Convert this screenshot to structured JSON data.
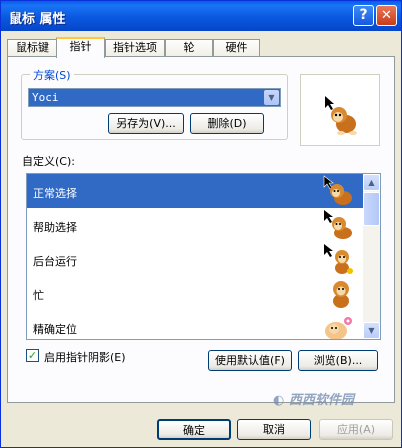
{
  "window": {
    "title": "鼠标 属性",
    "help_label": "?",
    "close_label": "✕"
  },
  "tabs": [
    {
      "label": "鼠标键"
    },
    {
      "label": "指针"
    },
    {
      "label": "指针选项"
    },
    {
      "label": "轮"
    },
    {
      "label": "硬件"
    }
  ],
  "scheme": {
    "legend": "方案(S)",
    "selected": "Yoci",
    "save_as_label": "另存为(V)...",
    "delete_label": "删除(D)"
  },
  "customize_label": "自定义(C):",
  "pointers": [
    {
      "label": "正常选择",
      "selected": true,
      "icon": "monkey-arrow-icon"
    },
    {
      "label": "帮助选择",
      "selected": false,
      "icon": "monkey-help-icon"
    },
    {
      "label": "后台运行",
      "selected": false,
      "icon": "monkey-busy-arrow-icon"
    },
    {
      "label": "忙",
      "selected": false,
      "icon": "monkey-busy-icon"
    },
    {
      "label": "精确定位",
      "selected": false,
      "icon": "monkey-precision-icon"
    }
  ],
  "shadow": {
    "label": "启用指针阴影(E)",
    "checked": true
  },
  "use_default_label": "使用默认值(F)",
  "browse_label": "浏览(B)...",
  "footer": {
    "ok_label": "确定",
    "cancel_label": "取消",
    "apply_label": "应用(A)"
  },
  "colors": {
    "accent": "#316ac5",
    "title_bar": "#0a58e0",
    "face": "#ece9d8",
    "tab_highlight": "#ffc73c"
  }
}
